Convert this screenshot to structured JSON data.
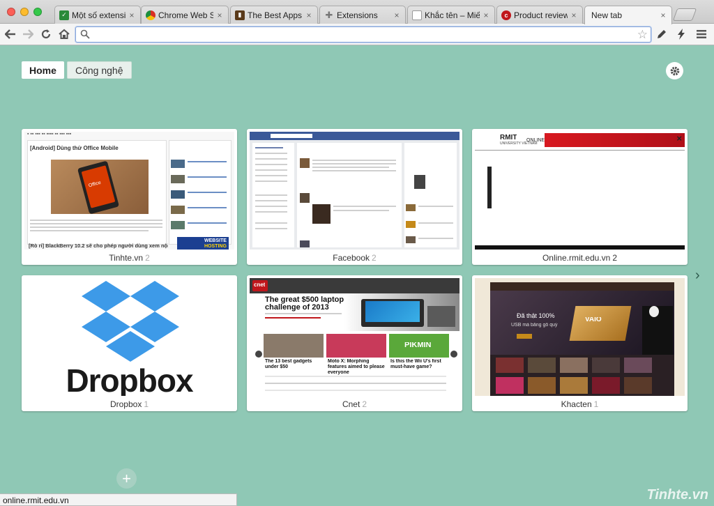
{
  "tabs": [
    {
      "title": "Một số extensio",
      "favicon": "check",
      "color": "#2a8a3a"
    },
    {
      "title": "Chrome Web Sto",
      "favicon": "chrome",
      "color": "#e0a000"
    },
    {
      "title": "The Best Apps a",
      "favicon": "book",
      "color": "#5a3a1a"
    },
    {
      "title": "Extensions",
      "favicon": "puzzle",
      "color": "#777777"
    },
    {
      "title": "Khắc tên – Miến",
      "favicon": "page",
      "color": "#999999"
    },
    {
      "title": "Product reviews",
      "favicon": "cnet",
      "color": "#c0161b"
    },
    {
      "title": "New tab",
      "favicon": "",
      "color": ""
    }
  ],
  "omnibox": {
    "value": "",
    "placeholder": ""
  },
  "page_tabs": {
    "home": "Home",
    "cong_nghe": "Công nghệ"
  },
  "tiles": [
    {
      "name": "Tinhte.vn",
      "count": "2"
    },
    {
      "name": "Facebook",
      "count": "2"
    },
    {
      "name": "Online.rmit.edu.vn",
      "count": "2"
    },
    {
      "name": "Dropbox",
      "count": "1"
    },
    {
      "name": "Cnet",
      "count": "2"
    },
    {
      "name": "Khacten",
      "count": "1"
    }
  ],
  "thumb_text": {
    "tinhte_headline": "[Android] Dùng thử Office Mobile",
    "tinhte_footer": "[Rò rỉ] BlackBerry 10.2 sẽ cho phép người dùng xem nội",
    "tinhte_office": "Office",
    "tinhte_website": "WEBSITE",
    "tinhte_hosting": "HOSTING",
    "rmit_logo": "RMIT",
    "rmit_sub": "UNIVERSITY VIETNAM",
    "rmit_online": "ONLINE",
    "dropbox_word": "Dropbox",
    "cnet_logo": "cnet",
    "cnet_headline": "The great $500 laptop challenge of 2013",
    "cnet_story1": "The 13 best gadgets under $50",
    "cnet_story2": "Moto X: Morphing features aimed to please everyone",
    "cnet_story3": "Is this the Wii U's first must-have game?",
    "cnet_pikmin": "PIKMIN",
    "khacten_line1": "Đã thật 100%",
    "khacten_line2": "USB mà bằng gỗ quý",
    "khacten_vaio": "VAIO"
  },
  "status_text": "online.rmit.edu.vn",
  "watermark": "Tinhte.vn",
  "icons": [
    "back-icon",
    "forward-icon",
    "reload-icon",
    "home-icon",
    "search-icon",
    "star-icon",
    "pen-icon",
    "bolt-icon",
    "menu-icon",
    "gear-icon",
    "chevron-right-icon",
    "plus-icon",
    "close-icon"
  ],
  "colors": {
    "page_bg": "#8fc8b5",
    "fb_blue": "#3b5998",
    "cnet_red": "#c0161b",
    "rmit_red": "#d71920",
    "dropbox_blue": "#3d9ae8"
  }
}
